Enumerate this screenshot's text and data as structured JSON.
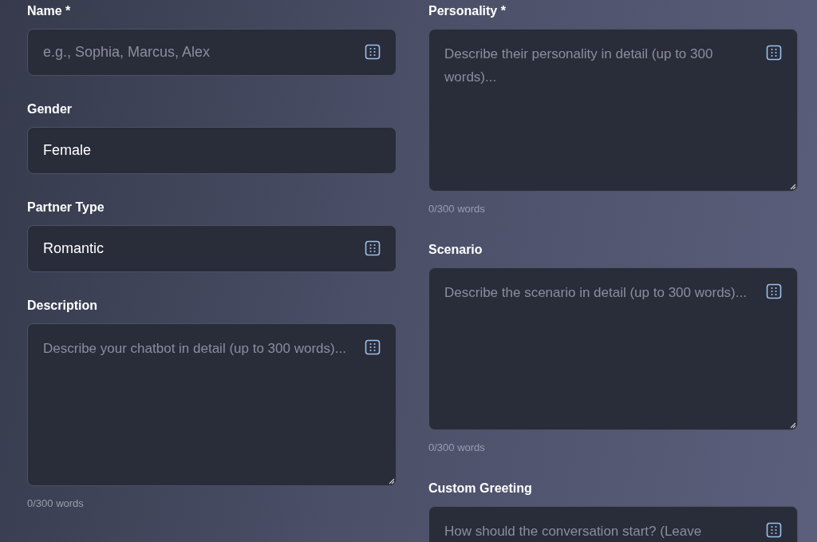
{
  "columns": [
    {
      "fields": [
        {
          "label": "Name *",
          "kind": "input",
          "placeholder": "e.g., Sophia, Marcus, Alex",
          "icon": true
        },
        {
          "label": "Gender",
          "kind": "input",
          "value": "Female",
          "icon": false
        },
        {
          "label": "Partner Type",
          "kind": "input",
          "value": "Romantic",
          "icon": true
        },
        {
          "label": "Description",
          "kind": "textarea",
          "placeholder": "Describe your chatbot in detail (up to 300 words)...",
          "icon": true,
          "counter": "0/300 words"
        }
      ]
    },
    {
      "fields": [
        {
          "label": "Personality *",
          "kind": "textarea",
          "placeholder": "Describe their personality in detail (up to 300 words)...",
          "icon": true,
          "counter": "0/300 words"
        },
        {
          "label": "Scenario",
          "kind": "textarea",
          "placeholder": "Describe the scenario in detail (up to 300 words)...",
          "icon": true,
          "counter": "0/300 words"
        },
        {
          "label": "Custom Greeting",
          "kind": "textarea",
          "placeholder": "How should the conversation start? (Leave",
          "icon": true
        }
      ]
    }
  ]
}
